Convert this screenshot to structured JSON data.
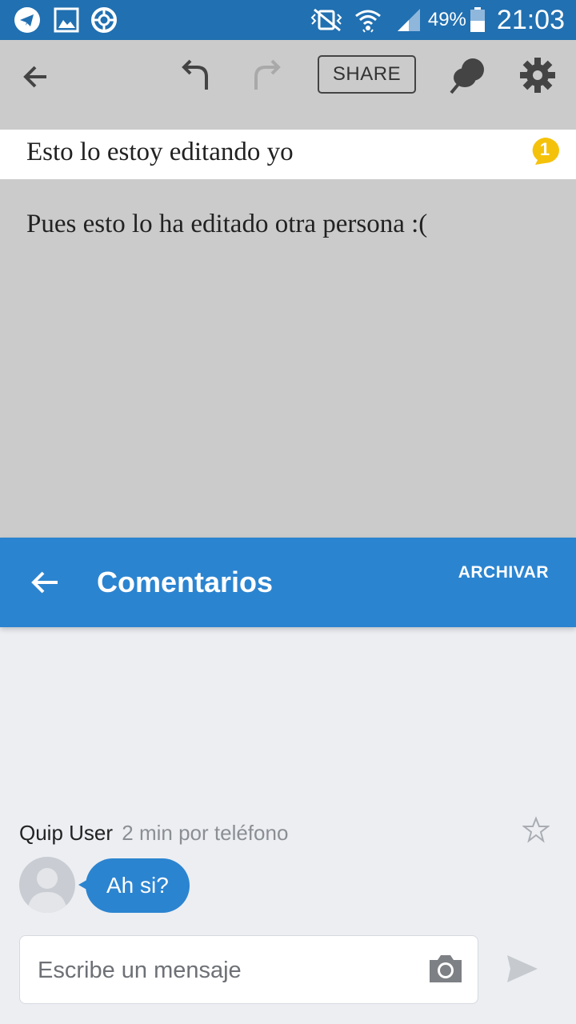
{
  "status_bar": {
    "battery": "49%",
    "time": "21:03",
    "icons": [
      "telegram-icon",
      "gallery-icon",
      "vpn-icon",
      "vibrate-icon",
      "wifi-icon",
      "signal-icon",
      "battery-icon"
    ]
  },
  "toolbar": {
    "share_label": "SHARE",
    "icons": [
      "back-arrow-icon",
      "undo-icon",
      "redo-icon",
      "pin-icon",
      "settings-icon"
    ]
  },
  "document": {
    "line1": "Esto lo estoy editando yo",
    "comment_count": "1",
    "line2": "Pues esto lo ha editado otra persona :("
  },
  "comments_panel": {
    "title": "Comentarios",
    "archive_label": "ARCHIVAR",
    "message": {
      "author": "Quip User",
      "meta": "2 min por teléfono",
      "text": "Ah si?"
    },
    "input_placeholder": "Escribe un mensaje"
  },
  "colors": {
    "status_bar": "#2170b1",
    "accent": "#2b84d0",
    "badge": "#f5c20b",
    "toolbar_bg": "#cbcbcb",
    "panel_bg": "#eceef2"
  }
}
